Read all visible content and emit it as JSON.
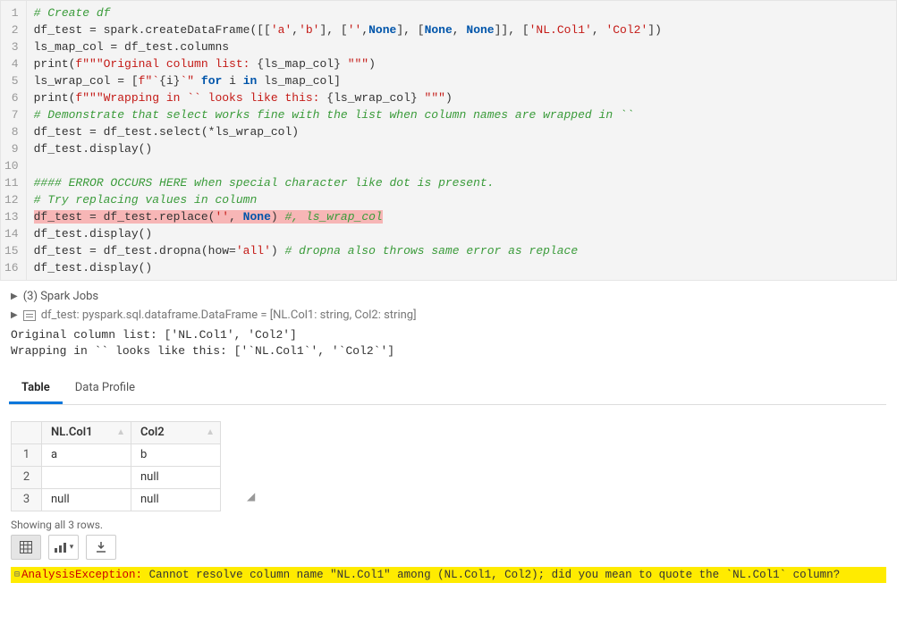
{
  "code": {
    "lines": [
      {
        "n": 1,
        "segments": [
          {
            "t": "# Create df",
            "c": "c-comment"
          }
        ]
      },
      {
        "n": 2,
        "segments": [
          {
            "t": "df_test = spark.createDataFrame([[",
            "c": "c-ident"
          },
          {
            "t": "'a'",
            "c": "c-str"
          },
          {
            "t": ",",
            "c": "c-ident"
          },
          {
            "t": "'b'",
            "c": "c-str"
          },
          {
            "t": "], [",
            "c": "c-ident"
          },
          {
            "t": "''",
            "c": "c-str"
          },
          {
            "t": ",",
            "c": "c-ident"
          },
          {
            "t": "None",
            "c": "c-const"
          },
          {
            "t": "], [",
            "c": "c-ident"
          },
          {
            "t": "None",
            "c": "c-const"
          },
          {
            "t": ", ",
            "c": "c-ident"
          },
          {
            "t": "None",
            "c": "c-const"
          },
          {
            "t": "]], [",
            "c": "c-ident"
          },
          {
            "t": "'NL.Col1'",
            "c": "c-str"
          },
          {
            "t": ", ",
            "c": "c-ident"
          },
          {
            "t": "'Col2'",
            "c": "c-str"
          },
          {
            "t": "])",
            "c": "c-ident"
          }
        ]
      },
      {
        "n": 3,
        "segments": [
          {
            "t": "ls_map_col = df_test.columns",
            "c": "c-ident"
          }
        ]
      },
      {
        "n": 4,
        "segments": [
          {
            "t": "print(",
            "c": "c-ident"
          },
          {
            "t": "f\"\"\"Original column list: ",
            "c": "c-strf"
          },
          {
            "t": "{",
            "c": "c-ident"
          },
          {
            "t": "ls_map_col",
            "c": "c-ident"
          },
          {
            "t": "}",
            "c": "c-ident"
          },
          {
            "t": " \"\"\"",
            "c": "c-strf"
          },
          {
            "t": ")",
            "c": "c-ident"
          }
        ]
      },
      {
        "n": 5,
        "segments": [
          {
            "t": "ls_wrap_col = [",
            "c": "c-ident"
          },
          {
            "t": "f\"`",
            "c": "c-strf"
          },
          {
            "t": "{",
            "c": "c-ident"
          },
          {
            "t": "i",
            "c": "c-ident"
          },
          {
            "t": "}",
            "c": "c-ident"
          },
          {
            "t": "`\"",
            "c": "c-strf"
          },
          {
            "t": " ",
            "c": "c-ident"
          },
          {
            "t": "for",
            "c": "c-kw"
          },
          {
            "t": " i ",
            "c": "c-ident"
          },
          {
            "t": "in",
            "c": "c-kw"
          },
          {
            "t": " ls_map_col]",
            "c": "c-ident"
          }
        ]
      },
      {
        "n": 6,
        "segments": [
          {
            "t": "print(",
            "c": "c-ident"
          },
          {
            "t": "f\"\"\"Wrapping in `` looks like this: ",
            "c": "c-strf"
          },
          {
            "t": "{",
            "c": "c-ident"
          },
          {
            "t": "ls_wrap_col",
            "c": "c-ident"
          },
          {
            "t": "}",
            "c": "c-ident"
          },
          {
            "t": " \"\"\"",
            "c": "c-strf"
          },
          {
            "t": ")",
            "c": "c-ident"
          }
        ]
      },
      {
        "n": 7,
        "segments": [
          {
            "t": "# Demonstrate that select works fine with the list when column names are wrapped in ``",
            "c": "c-comment"
          }
        ]
      },
      {
        "n": 8,
        "segments": [
          {
            "t": "df_test = df_test.select(*ls_wrap_col)",
            "c": "c-ident"
          }
        ]
      },
      {
        "n": 9,
        "segments": [
          {
            "t": "df_test.display()",
            "c": "c-ident"
          }
        ]
      },
      {
        "n": 10,
        "segments": [
          {
            "t": "",
            "c": "c-ident"
          }
        ]
      },
      {
        "n": 11,
        "segments": [
          {
            "t": "#### ERROR OCCURS HERE when special character like dot is present.",
            "c": "c-comment"
          }
        ]
      },
      {
        "n": 12,
        "segments": [
          {
            "t": "# Try replacing values in column",
            "c": "c-comment"
          }
        ]
      },
      {
        "n": 13,
        "hl": "hl-red",
        "segments": [
          {
            "t": "df_test = df_test.replace(",
            "c": "c-ident"
          },
          {
            "t": "''",
            "c": "c-str"
          },
          {
            "t": ", ",
            "c": "c-ident"
          },
          {
            "t": "None",
            "c": "c-const"
          },
          {
            "t": ")",
            "c": "c-ident"
          },
          {
            "t": " #, ls_wrap_col",
            "c": "c-comment"
          }
        ]
      },
      {
        "n": 14,
        "segments": [
          {
            "t": "df_test.display()",
            "c": "c-ident"
          }
        ]
      },
      {
        "n": 15,
        "segments": [
          {
            "t": "df_test = df_test.dropna(how=",
            "c": "c-ident"
          },
          {
            "t": "'all'",
            "c": "c-str"
          },
          {
            "t": ")",
            "c": "c-ident"
          },
          {
            "t": " # dropna also throws same error as replace",
            "c": "c-comment"
          }
        ]
      },
      {
        "n": 16,
        "segments": [
          {
            "t": "df_test.display()",
            "c": "c-ident"
          }
        ]
      }
    ]
  },
  "output": {
    "spark_jobs": "(3) Spark Jobs",
    "schema_line": "df_test:  pyspark.sql.dataframe.DataFrame = [NL.Col1: string, Col2: string]",
    "stdout1": "Original column list: ['NL.Col1', 'Col2'] ",
    "stdout2": "Wrapping in `` looks like this: ['`NL.Col1`', '`Col2`'] "
  },
  "tabs": {
    "table": "Table",
    "profile": "Data Profile"
  },
  "table": {
    "headers": [
      "NL.Col1",
      "Col2"
    ],
    "rows": [
      {
        "n": "1",
        "c1": "a",
        "c2": "b"
      },
      {
        "n": "2",
        "c1": "",
        "c2": "null"
      },
      {
        "n": "3",
        "c1": "null",
        "c2": "null"
      }
    ],
    "showing": "Showing all 3 rows."
  },
  "error": {
    "type": "AnalysisException:",
    "msg": " Cannot resolve column name \"NL.Col1\" among (NL.Col1, Col2); did you mean to quote the `NL.Col1` column?"
  }
}
